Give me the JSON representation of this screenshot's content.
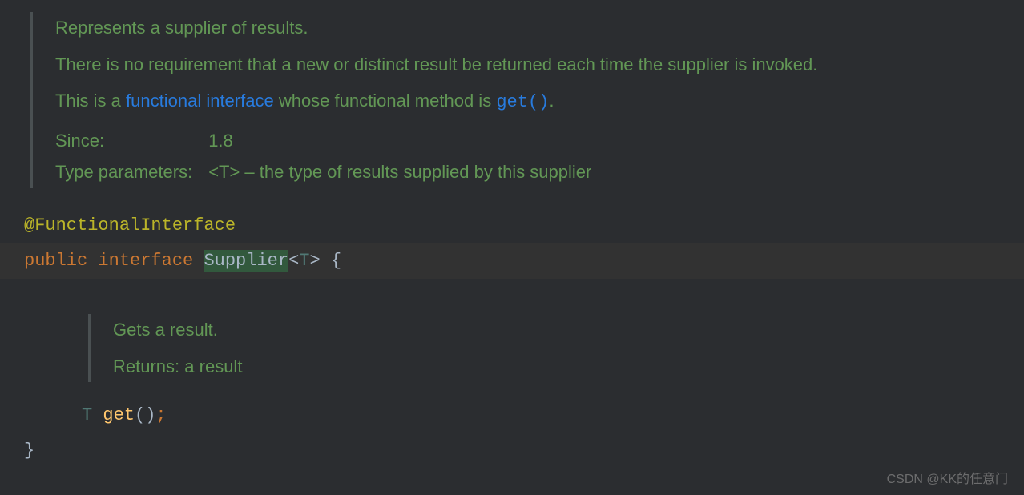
{
  "doc": {
    "line1": "Represents a supplier of results.",
    "line2": "There is no requirement that a new or distinct result be returned each time the supplier is invoked.",
    "line3_prefix": "This is a ",
    "line3_link": "functional interface",
    "line3_mid": " whose functional method is ",
    "line3_mono": "get()",
    "line3_suffix": ".",
    "since_label": "Since:",
    "since_value": "1.8",
    "typeparam_label": "Type parameters:",
    "typeparam_value": "<T> – the type of results supplied by this supplier"
  },
  "code": {
    "annotation": "@FunctionalInterface",
    "public": "public",
    "interface": "interface",
    "classname": "Supplier",
    "lt": "<",
    "typeparam": "T",
    "gt": ">",
    "open_brace": "{",
    "close_brace": "}"
  },
  "inner_doc": {
    "line1": "Gets a result.",
    "returns_label": "Returns:",
    "returns_value": "a result"
  },
  "method": {
    "return_type": "T",
    "name": "get",
    "parens": "()",
    "semi": ";"
  },
  "watermark": "CSDN @KK的任意门"
}
